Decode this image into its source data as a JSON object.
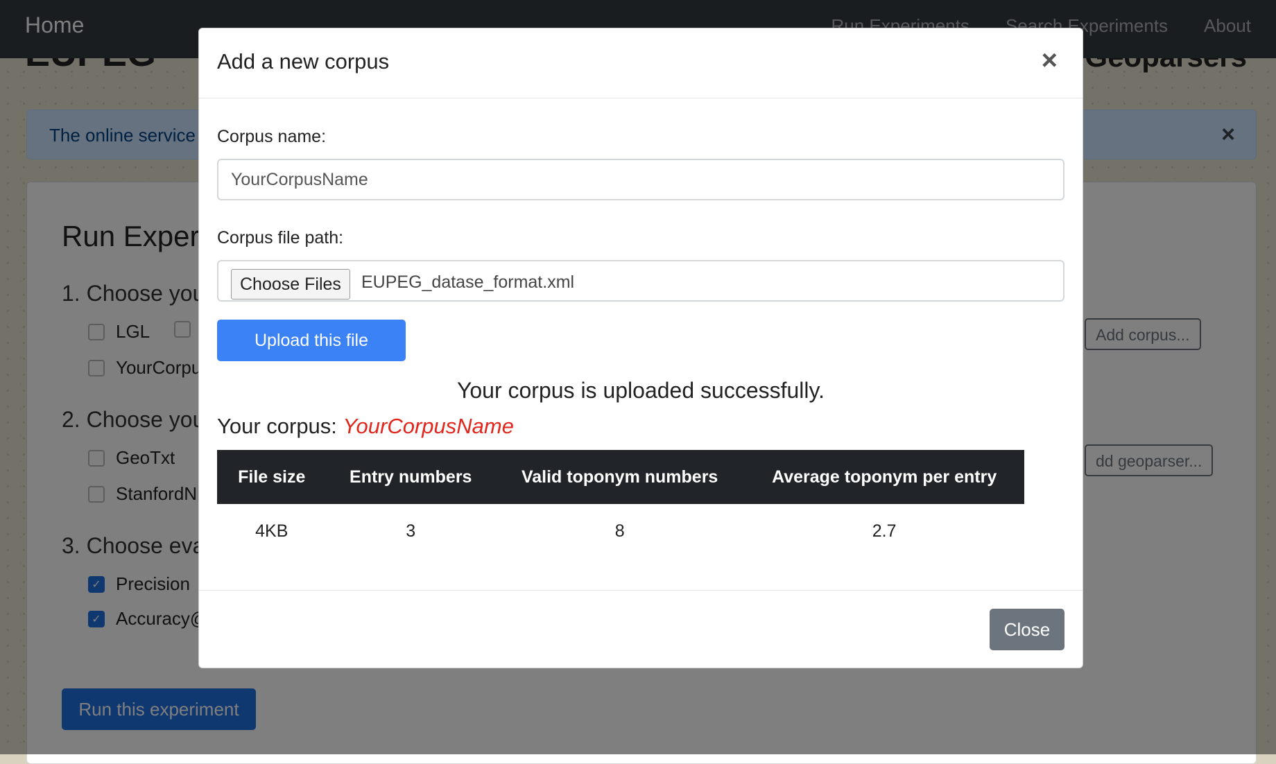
{
  "navbar": {
    "brand": "Home",
    "links": [
      "Run Experiments",
      "Search Experiments",
      "About"
    ]
  },
  "header": {
    "title": "EUPEG",
    "subtitle": "g Geoparsers"
  },
  "alert": {
    "text": "The online service",
    "close": "×"
  },
  "experiment": {
    "title": "Run Exper",
    "step1": "1. Choose you",
    "corpora": [
      "LGL",
      "YourCorpu"
    ],
    "add_corpus": "Add corpus...",
    "step2": "2. Choose you",
    "geoparsers": [
      "GeoTxt",
      "StanfordN"
    ],
    "add_geoparser": "dd geoparser...",
    "step3": "3. Choose eva",
    "metrics": [
      "Precision",
      "Accuracy@"
    ],
    "run_label": "Run this experiment"
  },
  "modal": {
    "title": "Add a new corpus",
    "close_symbol": "×",
    "corpus_name_label": "Corpus name:",
    "corpus_name_value": "YourCorpusName",
    "file_path_label": "Corpus file path:",
    "choose_files_label": "Choose Files",
    "file_name": "EUPEG_datase_format.xml",
    "upload_label": "Upload this file",
    "success_message": "Your corpus is uploaded successfully.",
    "your_corpus_label": "Your corpus:",
    "your_corpus_name": "YourCorpusName",
    "table": {
      "headers": [
        "File size",
        "Entry numbers",
        "Valid toponym numbers",
        "Average toponym per entry"
      ],
      "row": [
        "4KB",
        "3",
        "8",
        "2.7"
      ]
    },
    "close_label": "Close"
  }
}
